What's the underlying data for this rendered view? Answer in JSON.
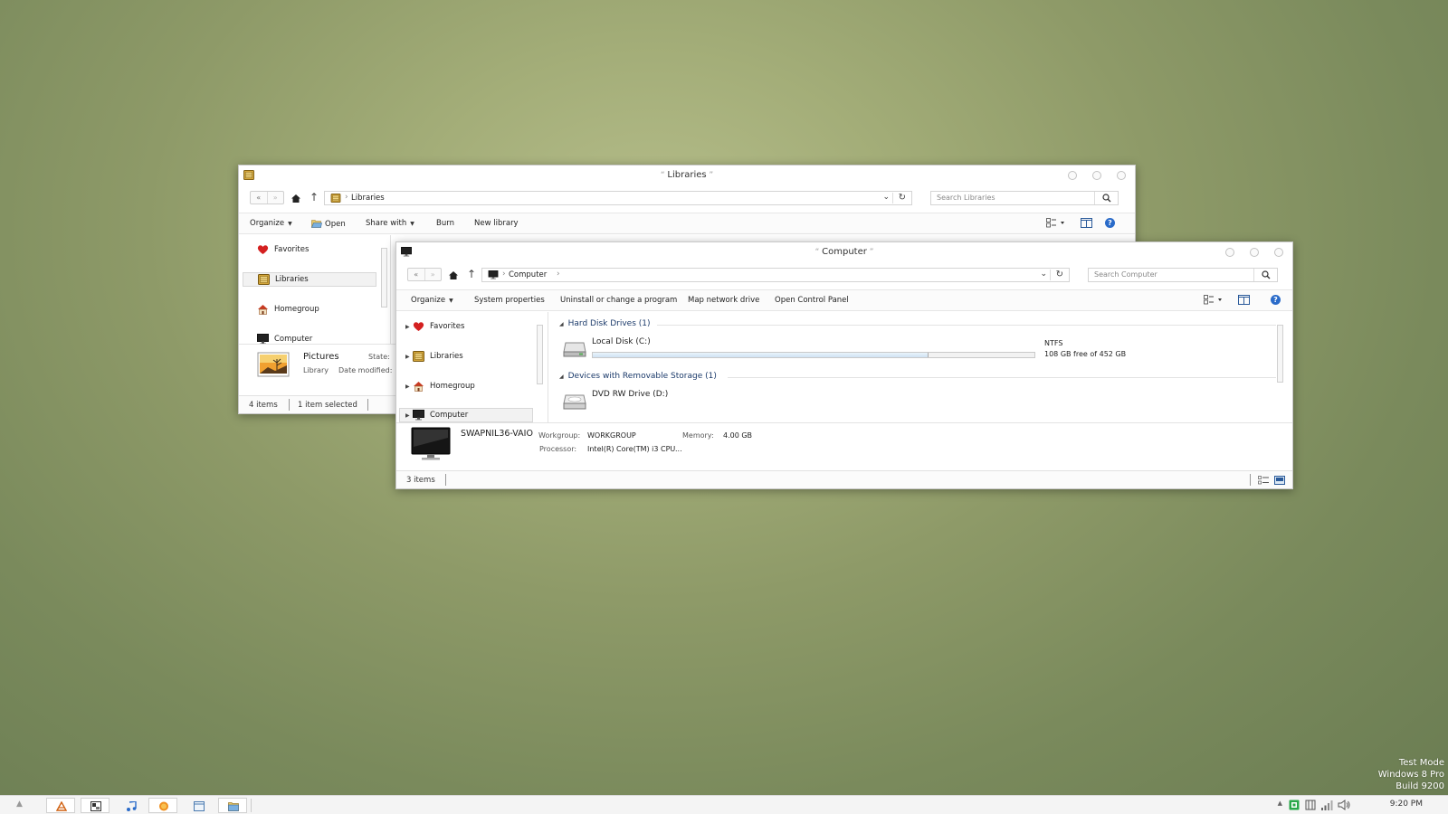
{
  "libraries_window": {
    "title": "Libraries",
    "address": "Libraries",
    "search_placeholder": "Search Libraries",
    "toolbar": {
      "organize": "Organize",
      "open": "Open",
      "share_with": "Share with",
      "burn": "Burn",
      "new_library": "New library"
    },
    "nav": [
      {
        "label": "Favorites"
      },
      {
        "label": "Libraries"
      },
      {
        "label": "Homegroup"
      },
      {
        "label": "Computer"
      }
    ],
    "details": {
      "name": "Pictures",
      "type": "Library",
      "state_label": "State:",
      "date_label": "Date modified:"
    },
    "status": {
      "items": "4 items",
      "selected": "1 item selected"
    }
  },
  "computer_window": {
    "title": "Computer",
    "address": "Computer",
    "search_placeholder": "Search Computer",
    "toolbar": {
      "organize": "Organize",
      "system_properties": "System properties",
      "uninstall": "Uninstall or change a program",
      "map_network": "Map network drive",
      "control_panel": "Open Control Panel"
    },
    "nav": [
      {
        "label": "Favorites"
      },
      {
        "label": "Libraries"
      },
      {
        "label": "Homegroup"
      },
      {
        "label": "Computer"
      }
    ],
    "groups": {
      "hdd": "Hard Disk Drives (1)",
      "removable": "Devices with Removable Storage (1)"
    },
    "drives": {
      "c_name": "Local Disk (C:)",
      "c_fs": "NTFS",
      "c_free": "108 GB free of 452 GB",
      "c_used_fraction": 0.76,
      "d_name": "DVD RW Drive (D:)"
    },
    "details": {
      "name": "SWAPNIL36-VAIO",
      "workgroup_label": "Workgroup:",
      "workgroup": "WORKGROUP",
      "memory_label": "Memory:",
      "memory": "4.00 GB",
      "processor_label": "Processor:",
      "processor": "Intel(R) Core(TM) i3 CPU",
      "processor_more": "..."
    },
    "status": {
      "items": "3 items"
    }
  },
  "taskbar": {
    "clock": "9:20 PM"
  },
  "watermark": {
    "line1": "Test Mode",
    "line2": "Windows 8 Pro",
    "line3": "Build 9200"
  },
  "colors": {
    "accent": "#2a6bc9",
    "library_icon": "#c8a030",
    "favorites_heart": "#d42020"
  }
}
